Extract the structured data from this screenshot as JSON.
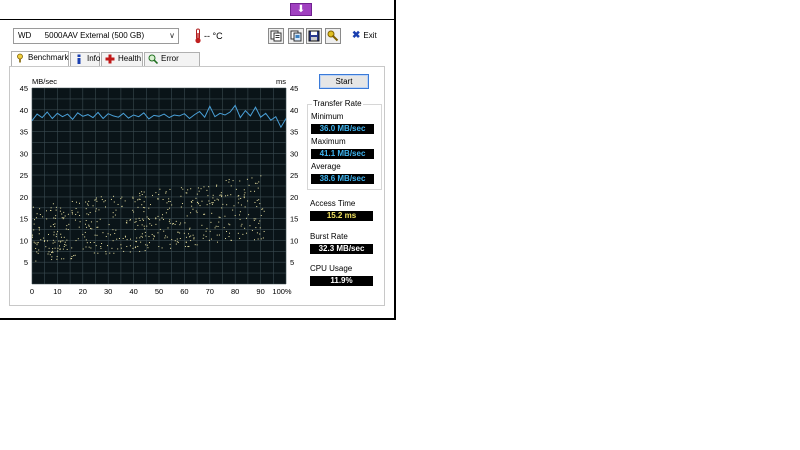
{
  "window": {
    "drive_name": "WD      5000AAV External (500 GB)",
    "temperature": "-- °C",
    "exit_label": "Exit"
  },
  "tabs": [
    {
      "label": "Benchmark",
      "icon": "benchmark-icon"
    },
    {
      "label": "Info",
      "icon": "info-icon"
    },
    {
      "label": "Health",
      "icon": "health-cross-icon"
    },
    {
      "label": "Error Scan",
      "icon": "magnifier-icon"
    }
  ],
  "start_label": "Start",
  "transfer_rate": {
    "title": "Transfer Rate",
    "minimum_label": "Minimum",
    "minimum_value": "36.0 MB/sec",
    "maximum_label": "Maximum",
    "maximum_value": "41.1 MB/sec",
    "average_label": "Average",
    "average_value": "38.6 MB/sec"
  },
  "access_time": {
    "label": "Access Time",
    "value": "15.2 ms"
  },
  "burst_rate": {
    "label": "Burst Rate",
    "value": "32.3 MB/sec"
  },
  "cpu_usage": {
    "label": "CPU Usage",
    "value": "11.9%"
  },
  "colors": {
    "plot_bg": "#0a1418",
    "grid": "#3a4a50",
    "transfer_line": "#4aa0d8",
    "access_dots": "#e8e0a0"
  },
  "chart_data": {
    "type": "line",
    "left_axis_label": "MB/sec",
    "right_axis_label": "ms",
    "y_ticks": [
      5,
      10,
      15,
      20,
      25,
      30,
      35,
      40,
      45
    ],
    "x_ticks": [
      "0",
      "10",
      "20",
      "30",
      "40",
      "50",
      "60",
      "70",
      "80",
      "90",
      "100%"
    ],
    "xlim": [
      0,
      100
    ],
    "ylim": [
      0,
      45
    ],
    "grid": true,
    "transfer_series": {
      "x": [
        0,
        2,
        4,
        6,
        8,
        10,
        12,
        14,
        16,
        18,
        20,
        22,
        24,
        26,
        28,
        30,
        32,
        34,
        36,
        38,
        40,
        42,
        44,
        46,
        48,
        50,
        52,
        54,
        56,
        58,
        60,
        62,
        64,
        66,
        68,
        70,
        72,
        74,
        76,
        78,
        80,
        82,
        84,
        86,
        88,
        90,
        92,
        94,
        96,
        98,
        100
      ],
      "values": [
        37.5,
        39.0,
        38.2,
        39.5,
        38.0,
        39.2,
        38.4,
        39.0,
        37.8,
        39.3,
        38.5,
        38.9,
        38.2,
        39.4,
        38.0,
        39.1,
        38.6,
        38.3,
        39.2,
        38.1,
        38.8,
        38.4,
        39.3,
        37.9,
        38.7,
        38.5,
        39.0,
        38.2,
        38.8,
        38.6,
        39.1,
        38.0,
        38.9,
        39.6,
        38.3,
        40.8,
        38.4,
        39.2,
        38.8,
        39.5,
        41.0,
        38.2,
        39.8,
        38.6,
        40.6,
        38.3,
        39.2,
        37.6,
        38.4,
        36.0,
        38.0
      ]
    },
    "access_cloud": {
      "x_range": [
        0,
        92
      ],
      "lower_start": 5,
      "lower_end": 11,
      "upper_start": 18,
      "upper_end": 26
    }
  }
}
